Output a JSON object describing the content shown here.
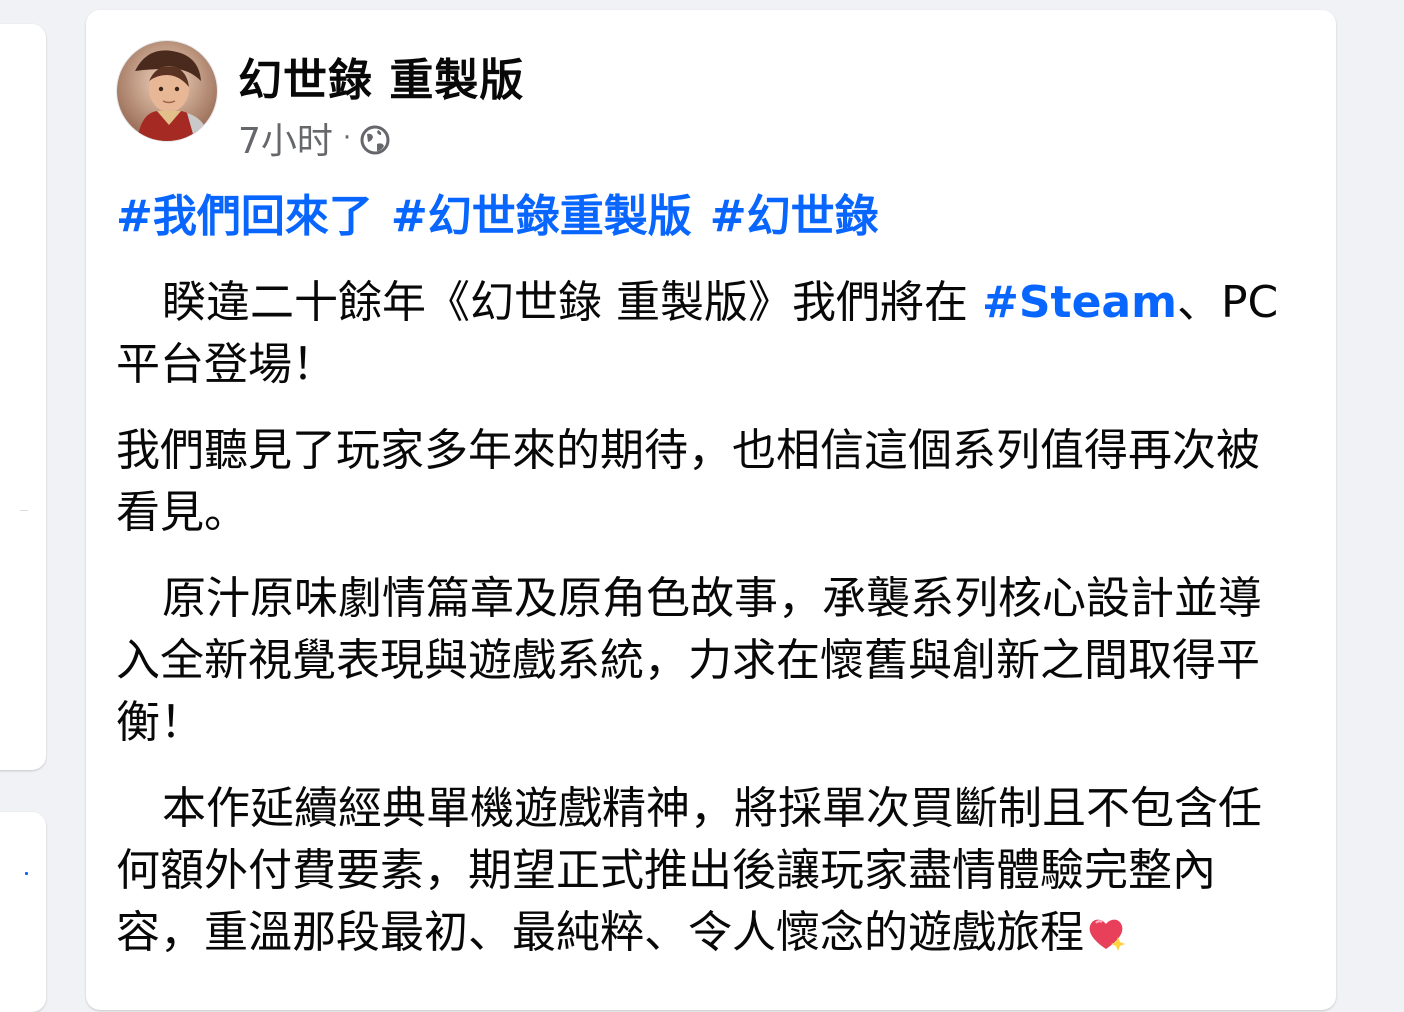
{
  "post": {
    "author": "幻世錄 重製版",
    "time": "7小时",
    "separator": "·",
    "privacy_icon": "globe-icon",
    "hashtags": [
      "#我們回來了",
      "#幻世錄重製版",
      "#幻世錄"
    ],
    "para1_before": "睽違二十餘年《幻世錄 重製版》我們將在 ",
    "para1_link": "#Steam",
    "para1_after": "、PC平台登場！",
    "para2": "我們聽見了玩家多年來的期待，也相信這個系列值得再次被看見。",
    "para3": "原汁原味劇情篇章及原角色故事，承襲系列核心設計並導入全新視覺表現與遊戲系統，力求在懷舊與創新之間取得平衡！",
    "para4": "本作延續經典單機遊戲精神，將採單次買斷制且不包含任何額外付費要素，期望正式推出後讓玩家盡情體驗完整內容，重溫那段最初、最純粹、令人懷念的遊戲旅程",
    "para4_emoji": "sparkling-heart-icon"
  },
  "colors": {
    "link": "#0866ff",
    "text": "#080809",
    "secondary": "#65676b",
    "background": "#f0f2f5"
  }
}
